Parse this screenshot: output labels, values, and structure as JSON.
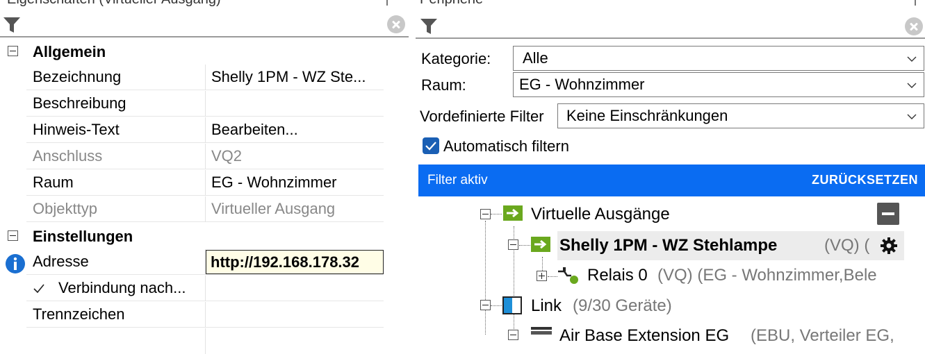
{
  "left_panel": {
    "title": "Eigenschaften (Virtueller Ausgang)",
    "categories": [
      {
        "label": "Allgemein"
      },
      {
        "label": "Einstellungen"
      }
    ],
    "general_rows": [
      {
        "name": "Bezeichnung",
        "value": "Shelly 1PM - WZ Ste..."
      },
      {
        "name": "Beschreibung",
        "value": ""
      },
      {
        "name": "Hinweis-Text",
        "value": "Bearbeiten..."
      },
      {
        "name": "Anschluss",
        "value": "VQ2"
      },
      {
        "name": "Raum",
        "value": "EG - Wohnzimmer"
      },
      {
        "name": "Objekttyp",
        "value": "Virtueller Ausgang"
      }
    ],
    "settings_rows": [
      {
        "name": "Adresse",
        "value": "http://192.168.178.32"
      },
      {
        "name": "Verbindung nach...",
        "value": "",
        "checked": true
      },
      {
        "name": "Trennzeichen",
        "value": ""
      }
    ]
  },
  "right_panel": {
    "title": "Peripherie",
    "kategorie_label": "Kategorie:",
    "kategorie_value": "Alle",
    "raum_label": "Raum:",
    "raum_value": "EG - Wohnzimmer",
    "vordef_label": "Vordefinierte Filter",
    "vordef_value": "Keine Einschränkungen",
    "auto_filter_label": "Automatisch filtern",
    "auto_filter_checked": true,
    "banner_text": "Filter aktiv",
    "banner_reset": "ZURÜCKSETZEN"
  },
  "tree": {
    "virtual_outputs": "Virtuelle Ausgänge",
    "shelly_name": "Shelly 1PM - WZ Stehlampe",
    "shelly_suffix": "(VQ) (",
    "relais_name": "Relais 0",
    "relais_suffix": "(VQ) (EG - Wohnzimmer,Bele",
    "link_name": "Link",
    "link_suffix": "(9/30 Geräte)",
    "air_base_name": "Air Base Extension EG",
    "air_base_suffix": "(EBU, Verteiler EG,"
  },
  "colors": {
    "banner": "#0a6cf2",
    "output_icon": "#6aa81e",
    "info_icon": "#1a6fd1",
    "checkbox": "#1a5fb4",
    "link_icon": "#1e8fd8"
  },
  "icons": [
    "funnel-icon",
    "clear-filter-icon",
    "info-icon",
    "chevron-down-icon",
    "gear-icon",
    "collapse-icon",
    "output-arrow-icon",
    "relay-icon",
    "link-icon"
  ]
}
